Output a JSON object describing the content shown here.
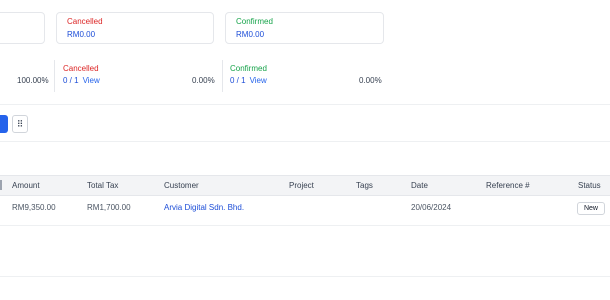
{
  "summary_cards": [
    {
      "title": "Cancelled",
      "value": "RM0.00"
    },
    {
      "title": "Confirmed",
      "value": "RM0.00"
    }
  ],
  "stats": {
    "first_percent": "100.00%",
    "cancelled": {
      "title": "Cancelled",
      "count": "0 / 1",
      "link": "View",
      "percent": "0.00%"
    },
    "confirmed": {
      "title": "Confirmed",
      "count": "0 / 1",
      "link": "View",
      "percent": "0.00%"
    }
  },
  "toolbar": {
    "grid_icon_glyph": "⠿"
  },
  "table": {
    "columns": [
      "Amount",
      "Total Tax",
      "Customer",
      "Project",
      "Tags",
      "Date",
      "Reference #",
      "Status"
    ],
    "rows": [
      {
        "amount": "RM9,350.00",
        "total_tax": "RM1,700.00",
        "customer": "Arvia Digital Sdn. Bhd.",
        "project": "",
        "tags": "",
        "date": "20/06/2024",
        "reference": "",
        "status": "New"
      }
    ]
  }
}
